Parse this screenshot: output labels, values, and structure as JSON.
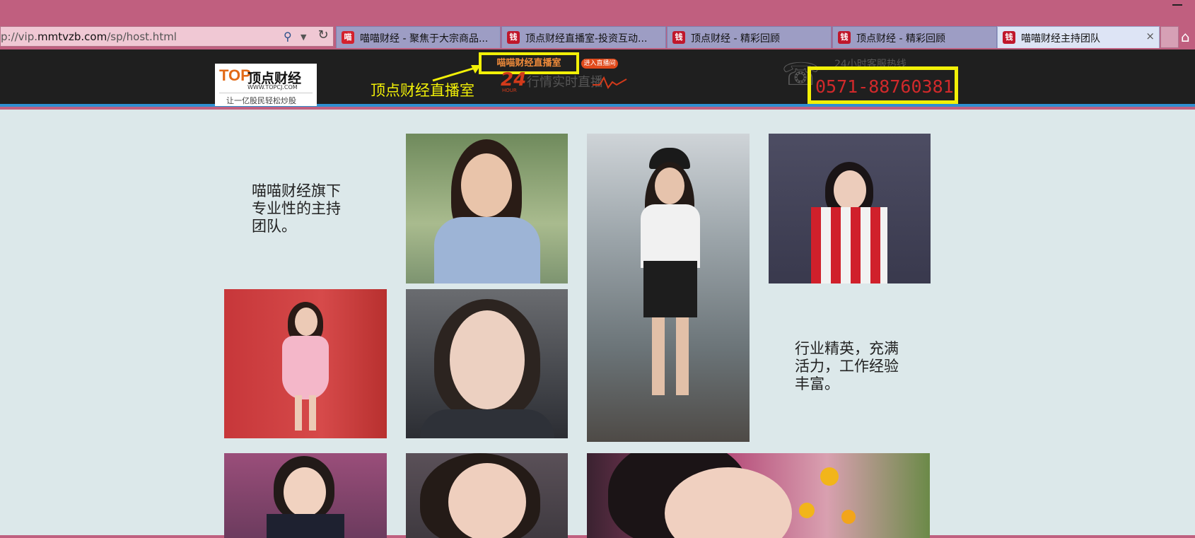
{
  "browser": {
    "address_prefix": "p://vip.",
    "address_domain": "mmtvzb.com",
    "address_path": "/sp/host.html",
    "tabs": [
      {
        "label": "喵喵财经 - 聚焦于大宗商品..."
      },
      {
        "label": "顶点财经直播室-投资互动..."
      },
      {
        "label": "顶点财经 - 精彩回顾"
      },
      {
        "label": "顶点财经 - 精彩回顾"
      },
      {
        "label": "喵喵财经主持团队"
      }
    ],
    "close_glyph": "×"
  },
  "header": {
    "logo_mark": "TOP",
    "logo_name": "顶点财经",
    "logo_url": "WWW.TOPCJ.COM",
    "logo_slogan": "让一亿股民轻松炒股",
    "live_room": "喵喵财经直播室",
    "enter_badge": "进入直播间",
    "h24": "24",
    "hour": "HOUR",
    "live_sub": "行情实时直播",
    "live_annotation": "顶点财经直播室",
    "hotline_label": "24小时客服热线",
    "phone": "0571-88760381"
  },
  "content": {
    "intro_1": "喵喵财经旗下专业性的主持团队。",
    "intro_2": "行业精英，充满活力，工作经验丰富。"
  },
  "colors": {
    "chrome": "#c05f7f",
    "header_bg": "#1f1f1f",
    "highlight": "#f2f007",
    "content_bg": "#dce8ea",
    "phone_red": "#d1292b"
  }
}
